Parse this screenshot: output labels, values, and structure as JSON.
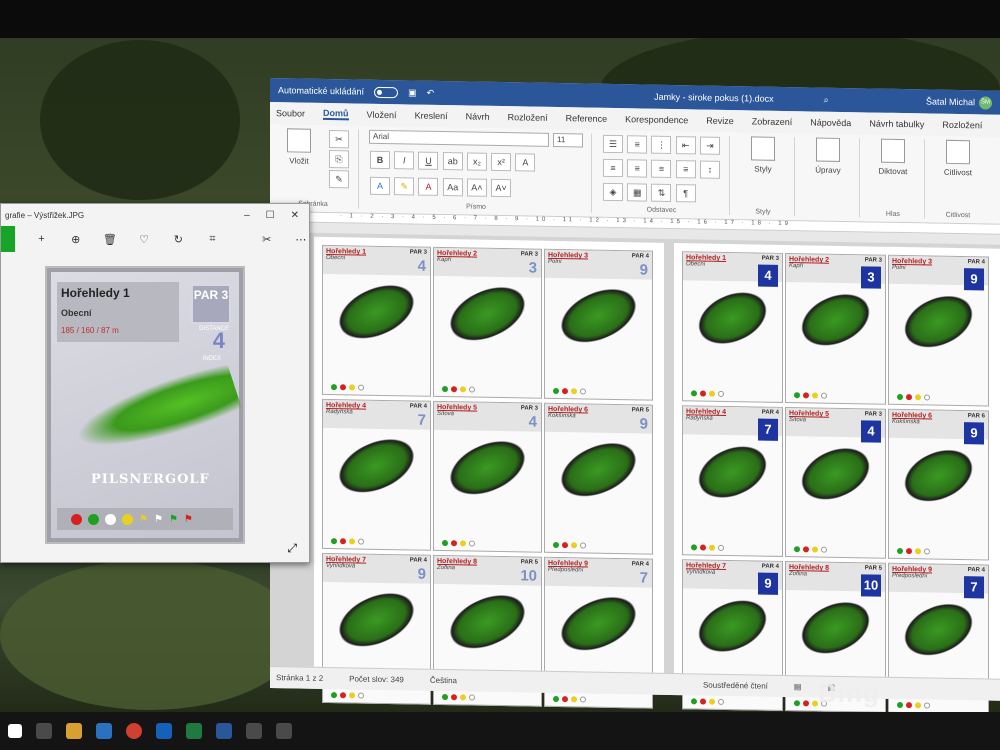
{
  "word": {
    "autosave_label": "Automatické ukládání",
    "doc_title": "Jamky - siroke pokus (1).docx",
    "user_name": "Šatal Michal",
    "user_initials": "ŠM",
    "tabs": [
      "Soubor",
      "Domů",
      "Vložení",
      "Kreslení",
      "Návrh",
      "Rozložení",
      "Reference",
      "Korespondence",
      "Revize",
      "Zobrazení",
      "Nápověda",
      "Návrh tabulky",
      "Rozložení"
    ],
    "ribbon": {
      "paste": "Vložit",
      "clipboard": "Schránka",
      "font_name": "Arial",
      "font_size": "11",
      "font_group": "Písmo",
      "paragraph_group": "Odstavec",
      "styles": "Styly",
      "styles_group": "Styly",
      "editing": "Úpravy",
      "dictate": "Diktovat",
      "voice_group": "Hlas",
      "sensitivity": "Citlivost",
      "sensitivity_group": "Citlivost"
    },
    "ruler": "· 1 · 2 · 3 · 4 · 5 · 6 · 7 · 8 · 9 · 10 · 11 · 12 · 13 · 14 · 15 · 16 · 17 · 18 · 19",
    "status": {
      "page": "Stránka 1 z 2",
      "words": "Počet slov: 349",
      "language": "Čeština",
      "focus": "Soustředěné čtení"
    }
  },
  "page_left": [
    {
      "name": "Hořehledy 1",
      "sub": "Obecní",
      "par": "PAR 3",
      "num": "4"
    },
    {
      "name": "Hořehledy 2",
      "sub": "Kapří",
      "par": "PAR 3",
      "num": "3"
    },
    {
      "name": "Hořehledy 3",
      "sub": "Polní",
      "par": "PAR 4",
      "num": "9"
    },
    {
      "name": "Hořehledy 4",
      "sub": "Radyňská",
      "par": "PAR 4",
      "num": "7"
    },
    {
      "name": "Hořehledy 5",
      "sub": "Sítová",
      "par": "PAR 3",
      "num": "4"
    },
    {
      "name": "Hořehledy 6",
      "sub": "Kokšínská",
      "par": "PAR 5",
      "num": "9"
    },
    {
      "name": "Hořehledy 7",
      "sub": "Vyhlídková",
      "par": "PAR 4",
      "num": "9"
    },
    {
      "name": "Hořehledy 8",
      "sub": "Zoflina",
      "par": "PAR 5",
      "num": "10"
    },
    {
      "name": "Hořehledy 9",
      "sub": "Předposlední",
      "par": "PAR 4",
      "num": "7"
    }
  ],
  "page_right": [
    {
      "name": "Hořehledy 1",
      "sub": "Obecní",
      "par": "PAR 3",
      "num": "4"
    },
    {
      "name": "Hořehledy 2",
      "sub": "Kapří",
      "par": "PAR 3",
      "num": "3"
    },
    {
      "name": "Hořehledy 3",
      "sub": "Polní",
      "par": "PAR 4",
      "num": "9"
    },
    {
      "name": "Hořehledy 4",
      "sub": "Radyňská",
      "par": "PAR 4",
      "num": "7"
    },
    {
      "name": "Hořehledy 5",
      "sub": "Sítová",
      "par": "PAR 3",
      "num": "4"
    },
    {
      "name": "Hořehledy 6",
      "sub": "Kokšínská",
      "par": "PAR 6",
      "num": "9"
    },
    {
      "name": "Hořehledy 7",
      "sub": "Vyhlídková",
      "par": "PAR 4",
      "num": "9"
    },
    {
      "name": "Hořehledy 8",
      "sub": "Zoflina",
      "par": "PAR 5",
      "num": "10"
    },
    {
      "name": "Hořehledy 9",
      "sub": "Předposlední",
      "par": "PAR 4",
      "num": "7"
    }
  ],
  "photos": {
    "title": "grafie – Výstřižek.JPG",
    "card_name": "Hořehledy 1",
    "card_sub": "Obecní",
    "card_dist": "185 / 160 / 87 m",
    "par_label": "PAR 3",
    "distance_label": "DISTANCE",
    "index_num": "4",
    "index_label": "INDEX",
    "logo": "PILSNERGOLF"
  },
  "bing": "Bing",
  "colors": {
    "accent": "#2b579a",
    "index_box": "#1e34a0",
    "fairway": "#3b9a1c"
  }
}
